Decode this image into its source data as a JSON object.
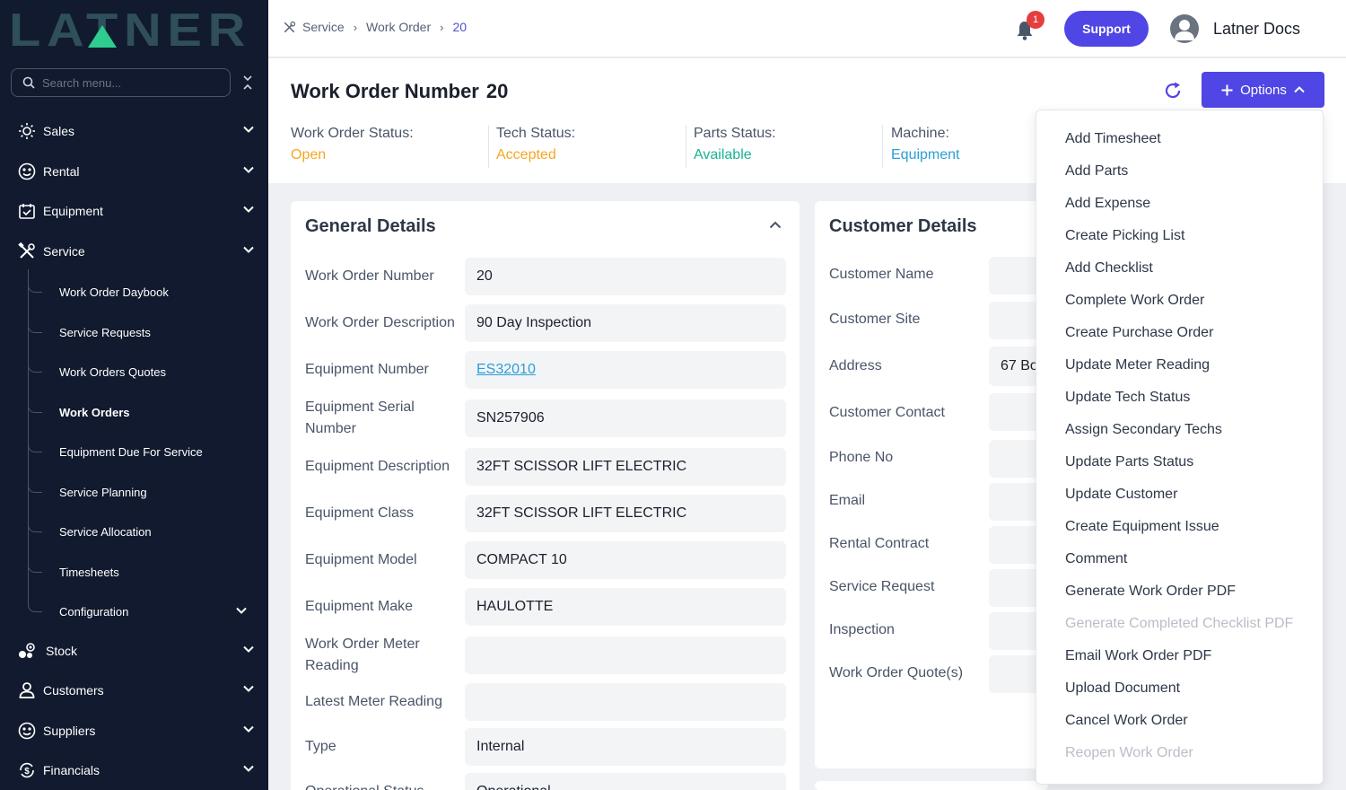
{
  "sidebar": {
    "logo_text": "LATNER",
    "search_placeholder": "Search menu...",
    "items": [
      {
        "label": "Sales"
      },
      {
        "label": "Rental"
      },
      {
        "label": "Equipment"
      },
      {
        "label": "Service"
      },
      {
        "label": "Stock"
      },
      {
        "label": "Customers"
      },
      {
        "label": "Suppliers"
      },
      {
        "label": "Financials"
      }
    ],
    "service_subitems": [
      {
        "label": "Work Order Daybook"
      },
      {
        "label": "Service Requests"
      },
      {
        "label": "Work Orders Quotes"
      },
      {
        "label": "Work Orders"
      },
      {
        "label": "Equipment Due For Service"
      },
      {
        "label": "Service Planning"
      },
      {
        "label": "Service Allocation"
      },
      {
        "label": "Timesheets"
      },
      {
        "label": "Configuration"
      }
    ]
  },
  "header": {
    "breadcrumb": [
      "Service",
      "Work Order",
      "20"
    ],
    "notification_count": "1",
    "support_label": "Support",
    "user_name": "Latner Docs"
  },
  "titlebar": {
    "title": "Work Order Number",
    "number": "20",
    "options_label": "Options",
    "statuses": [
      {
        "label": "Work Order Status:",
        "value": "Open",
        "color": "#f5a623"
      },
      {
        "label": "Tech Status:",
        "value": "Accepted",
        "color": "#f5a623"
      },
      {
        "label": "Parts Status:",
        "value": "Available",
        "color": "#1ab394"
      },
      {
        "label": "Machine:",
        "value": "Equipment",
        "color": "#2b9ed6"
      }
    ]
  },
  "general": {
    "title": "General Details",
    "fields": [
      {
        "label": "Work Order Number",
        "value": "20"
      },
      {
        "label": "Work Order Description",
        "value": "90 Day Inspection"
      },
      {
        "label": "Equipment Number",
        "value": "ES32010"
      },
      {
        "label": "Equipment Serial Number",
        "value": "SN257906"
      },
      {
        "label": "Equipment Description",
        "value": "32FT SCISSOR LIFT ELECTRIC"
      },
      {
        "label": "Equipment Class",
        "value": "32FT SCISSOR LIFT ELECTRIC"
      },
      {
        "label": "Equipment Model",
        "value": "COMPACT 10"
      },
      {
        "label": "Equipment Make",
        "value": "HAULOTTE"
      },
      {
        "label": "Work Order Meter Reading",
        "value": ""
      },
      {
        "label": "Latest Meter Reading",
        "value": ""
      },
      {
        "label": "Type",
        "value": "Internal"
      },
      {
        "label": "Operational Status",
        "value": "Operational"
      }
    ]
  },
  "customer": {
    "title": "Customer Details",
    "fields": [
      {
        "label": "Customer Name",
        "value": ""
      },
      {
        "label": "Customer Site",
        "value": ""
      },
      {
        "label": "Address",
        "value": "67 Bo"
      },
      {
        "label": "Customer Contact",
        "value": ""
      },
      {
        "label": "Phone No",
        "value": ""
      },
      {
        "label": "Email",
        "value": ""
      },
      {
        "label": "Rental Contract",
        "value": ""
      },
      {
        "label": "Service Request",
        "value": ""
      },
      {
        "label": "Inspection",
        "value": ""
      },
      {
        "label": "Work Order Quote(s)",
        "value": ""
      }
    ]
  },
  "options_menu": [
    {
      "label": "Add Timesheet",
      "disabled": false
    },
    {
      "label": "Add Parts",
      "disabled": false
    },
    {
      "label": "Add Expense",
      "disabled": false
    },
    {
      "label": "Create Picking List",
      "disabled": false
    },
    {
      "label": "Add Checklist",
      "disabled": false
    },
    {
      "label": "Complete Work Order",
      "disabled": false
    },
    {
      "label": "Create Purchase Order",
      "disabled": false
    },
    {
      "label": "Update Meter Reading",
      "disabled": false
    },
    {
      "label": "Update Tech Status",
      "disabled": false
    },
    {
      "label": "Assign Secondary Techs",
      "disabled": false
    },
    {
      "label": "Update Parts Status",
      "disabled": false
    },
    {
      "label": "Update Customer",
      "disabled": false
    },
    {
      "label": "Create Equipment Issue",
      "disabled": false
    },
    {
      "label": "Comment",
      "disabled": false
    },
    {
      "label": "Generate Work Order PDF",
      "disabled": false
    },
    {
      "label": "Generate Completed Checklist PDF",
      "disabled": true
    },
    {
      "label": "Email Work Order PDF",
      "disabled": false
    },
    {
      "label": "Upload Document",
      "disabled": false
    },
    {
      "label": "Cancel Work Order",
      "disabled": false
    },
    {
      "label": "Reopen Work Order",
      "disabled": true
    }
  ],
  "colors": {
    "sidebar_bg": "#111a2e",
    "logo_dark": "#2f4f5a",
    "logo_accent": "#2ecc8f",
    "primary": "#4f46e5",
    "badge": "#e53e3e"
  }
}
